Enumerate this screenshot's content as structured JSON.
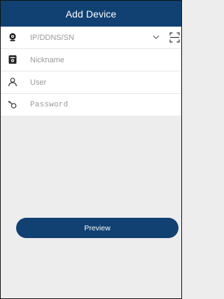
{
  "header": {
    "title": "Add Device"
  },
  "form": {
    "address": {
      "placeholder": "IP/DDNS/SN",
      "icon": "camera-icon",
      "dropdown_icon": "chevron-down-icon",
      "scan_icon": "scan-icon"
    },
    "nickname": {
      "placeholder": "Nickname",
      "icon": "device-card-icon"
    },
    "user": {
      "placeholder": "User",
      "icon": "user-icon"
    },
    "password": {
      "placeholder": "Password",
      "icon": "key-icon"
    }
  },
  "preview_button": {
    "label": "Preview"
  },
  "colors": {
    "brand": "#114172",
    "background": "#ededee",
    "field_background": "#ffffff"
  }
}
